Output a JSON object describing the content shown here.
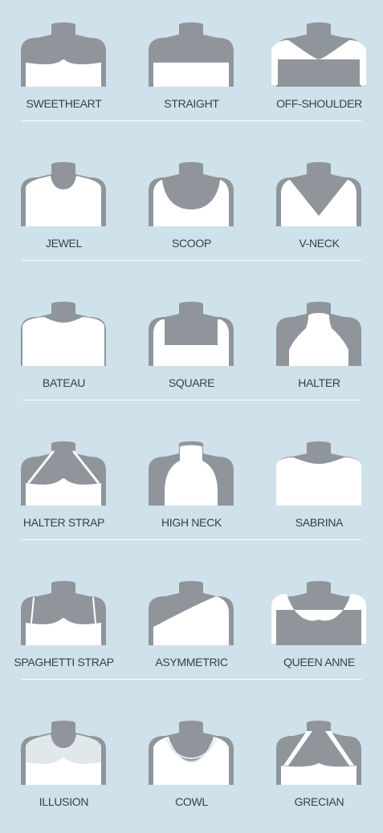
{
  "colors": {
    "background": "#cfe1ea",
    "mannequin": "#8f959b",
    "garment": "#ffffff",
    "sheer": "#e1e8ec",
    "label": "#3a3f44",
    "divider": "#ffffff"
  },
  "rows": [
    [
      {
        "label": "SWEETHEART",
        "style": "sweetheart"
      },
      {
        "label": "STRAIGHT",
        "style": "straight"
      },
      {
        "label": "OFF-SHOULDER",
        "style": "off-shoulder"
      }
    ],
    [
      {
        "label": "JEWEL",
        "style": "jewel"
      },
      {
        "label": "SCOOP",
        "style": "scoop"
      },
      {
        "label": "V-NECK",
        "style": "v-neck"
      }
    ],
    [
      {
        "label": "BATEAU",
        "style": "bateau"
      },
      {
        "label": "SQUARE",
        "style": "square"
      },
      {
        "label": "HALTER",
        "style": "halter"
      }
    ],
    [
      {
        "label": "HALTER STRAP",
        "style": "halter-strap"
      },
      {
        "label": "HIGH NECK",
        "style": "high-neck"
      },
      {
        "label": "SABRINA",
        "style": "sabrina"
      }
    ],
    [
      {
        "label": "SPAGHETTI STRAP",
        "style": "spaghetti-strap"
      },
      {
        "label": "ASYMMETRIC",
        "style": "asymmetric"
      },
      {
        "label": "QUEEN ANNE",
        "style": "queen-anne"
      }
    ],
    [
      {
        "label": "ILLUSION",
        "style": "illusion"
      },
      {
        "label": "COWL",
        "style": "cowl"
      },
      {
        "label": "GRECIAN",
        "style": "grecian"
      }
    ]
  ]
}
